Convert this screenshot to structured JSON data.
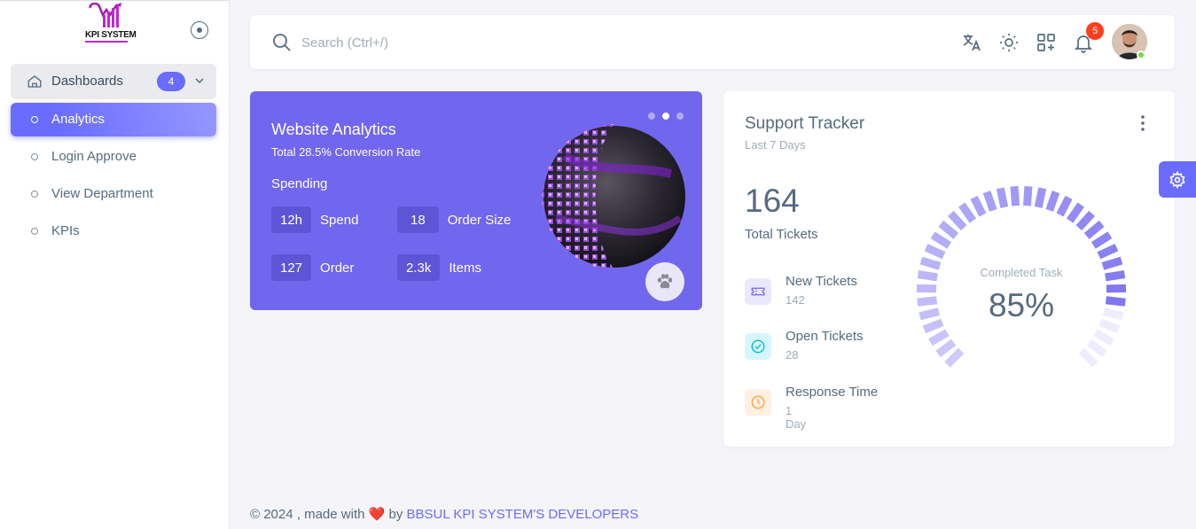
{
  "sidebar": {
    "logo_text": "KPI SYSTEM",
    "menu": {
      "dashboards_label": "Dashboards",
      "dashboards_badge": "4",
      "items": [
        {
          "label": "Analytics",
          "active": true
        },
        {
          "label": "Login Approve",
          "active": false
        },
        {
          "label": "View Department",
          "active": false
        },
        {
          "label": "KPIs",
          "active": false
        }
      ]
    }
  },
  "navbar": {
    "search_placeholder": "Search (Ctrl+/)",
    "notifications_count": "5",
    "icons": [
      "translate-icon",
      "sun-icon",
      "apps-icon",
      "bell-icon"
    ]
  },
  "website_analytics": {
    "title": "Website Analytics",
    "subtitle": "Total 28.5% Conversion Rate",
    "section": "Spending",
    "stats": [
      {
        "value": "12h",
        "label": "Spend"
      },
      {
        "value": "18",
        "label": "Order Size"
      },
      {
        "value": "127",
        "label": "Order"
      },
      {
        "value": "2.3k",
        "label": "Items"
      }
    ],
    "carousel_active_index": 1
  },
  "support_tracker": {
    "title": "Support Tracker",
    "subtitle": "Last 7 Days",
    "total": "164",
    "total_label": "Total Tickets",
    "items": [
      {
        "name": "New Tickets",
        "value": "142",
        "icon": "ticket-icon",
        "color": "#7367f0"
      },
      {
        "name": "Open Tickets",
        "value": "28",
        "icon": "check-circle-icon",
        "color": "#00cfe8"
      },
      {
        "name": "Response Time",
        "value": "1 Day",
        "icon": "clock-icon",
        "color": "#ff9f43"
      }
    ],
    "gauge": {
      "label": "Completed Task",
      "value": "85%",
      "percent": 85
    }
  },
  "footer": {
    "prefix": "© 2024 , made with",
    "heart": "❤️",
    "by": "by",
    "link": "BBSUL KPI SYSTEM'S DEVELOPERS"
  },
  "colors": {
    "primary": "#696cff",
    "card_purple": "#7166ee",
    "danger": "#ff3e1d",
    "success": "#71dd37"
  }
}
